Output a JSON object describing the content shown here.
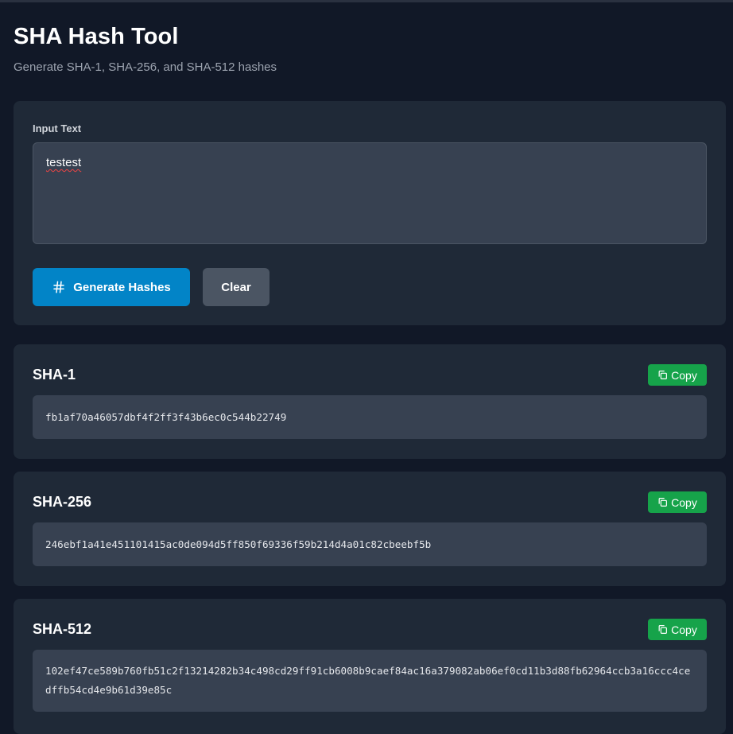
{
  "header": {
    "title": "SHA Hash Tool",
    "subtitle": "Generate SHA-1, SHA-256, and SHA-512 hashes"
  },
  "input": {
    "label": "Input Text",
    "value": "testest"
  },
  "buttons": {
    "generate_label": "Generate Hashes",
    "generate_icon": "hash-icon",
    "clear_label": "Clear"
  },
  "results": [
    {
      "title": "SHA-1",
      "copy_label": "Copy",
      "value": "fb1af70a46057dbf4f2ff3f43b6ec0c544b22749"
    },
    {
      "title": "SHA-256",
      "copy_label": "Copy",
      "value": "246ebf1a41e451101415ac0de094d5ff850f69336f59b214d4a01c82cbeebf5b"
    },
    {
      "title": "SHA-512",
      "copy_label": "Copy",
      "value": "102ef47ce589b760fb51c2f13214282b34c498cd29ff91cb6008b9caef84ac16a379082ab06ef0cd11b3d88fb62964ccb3a16ccc4cedffb54cd4e9b61d39e85c"
    }
  ],
  "colors": {
    "background": "#111827",
    "card": "#1f2937",
    "field": "#374151",
    "primary": "#0284c7",
    "secondary": "#4b5563",
    "success": "#16a34a"
  }
}
